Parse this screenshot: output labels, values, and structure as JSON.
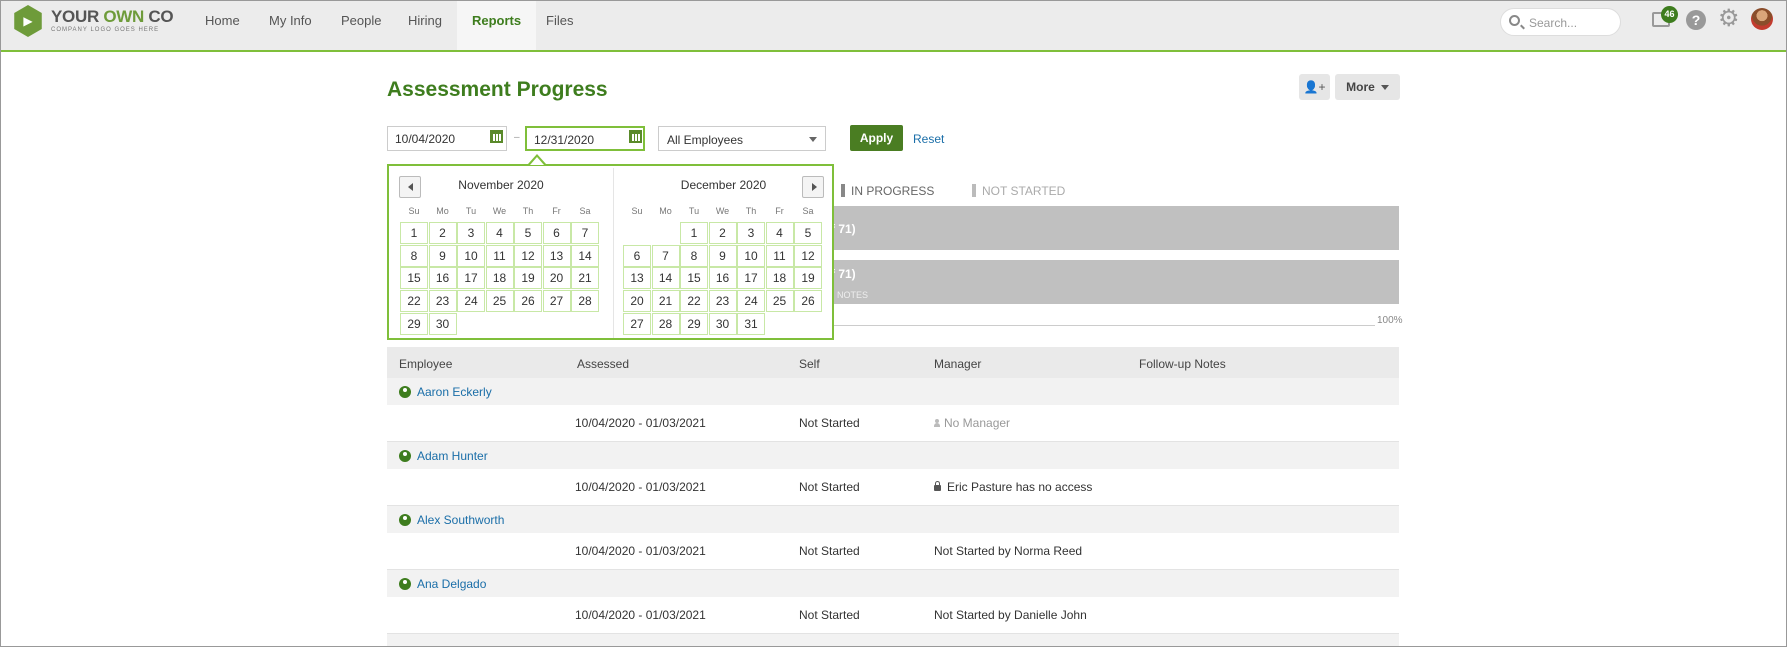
{
  "brand": {
    "name_part1": "YOUR ",
    "name_part2": "OWN",
    "name_part3": " CO",
    "tagline": "COMPANY LOGO GOES HERE",
    "accent": "#3e7d1e"
  },
  "nav": {
    "tabs": [
      {
        "label": "Home"
      },
      {
        "label": "My Info"
      },
      {
        "label": "People"
      },
      {
        "label": "Hiring"
      },
      {
        "label": "Reports",
        "active": true
      },
      {
        "label": "Files"
      }
    ],
    "search_placeholder": "Search...",
    "inbox_count": "46",
    "help_label": "?"
  },
  "page": {
    "title": "Assessment Progress",
    "more_label": "More"
  },
  "filters": {
    "start_date": "10/04/2020",
    "end_date": "12/31/2020",
    "employee_select": "All Employees",
    "apply_label": "Apply",
    "reset_label": "Reset"
  },
  "legend": {
    "in_progress": "IN PROGRESS",
    "not_started": "NOT STARTED"
  },
  "bars": {
    "bar1_text": "f 71)",
    "bar2_text": "f 71)",
    "bar2_sub": "NOTES",
    "axis_max": "100%"
  },
  "calendar": {
    "left_month": "November 2020",
    "right_month": "December 2020",
    "dow": [
      "Su",
      "Mo",
      "Tu",
      "We",
      "Th",
      "Fr",
      "Sa"
    ],
    "left_start": 0,
    "left_days": 30,
    "right_start": 2,
    "right_days": 31
  },
  "table": {
    "headers": {
      "employee": "Employee",
      "assessed": "Assessed",
      "self": "Self",
      "manager": "Manager",
      "notes": "Follow-up Notes"
    },
    "rows": [
      {
        "name": "Aaron Eckerly",
        "assessed": "10/04/2020 - 01/03/2021",
        "self": "Not Started",
        "manager": "No Manager",
        "manager_type": "none"
      },
      {
        "name": "Adam Hunter",
        "assessed": "10/04/2020 - 01/03/2021",
        "self": "Not Started",
        "manager": "Eric Pasture has no access",
        "manager_type": "locked"
      },
      {
        "name": "Alex Southworth",
        "assessed": "10/04/2020 - 01/03/2021",
        "self": "Not Started",
        "manager": "Not Started by Norma Reed",
        "manager_type": "normal"
      },
      {
        "name": "Ana Delgado",
        "assessed": "10/04/2020 - 01/03/2021",
        "self": "Not Started",
        "manager": "Not Started by Danielle John",
        "manager_type": "normal"
      }
    ]
  }
}
